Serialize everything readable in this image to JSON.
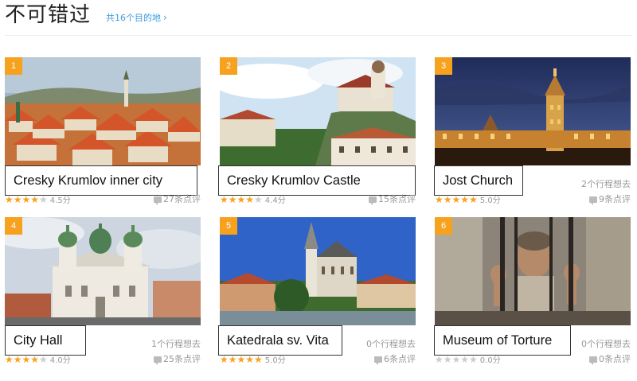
{
  "header": {
    "title": "不可错过",
    "more_link": "共16个目的地",
    "more_icon": "chevron-right-icon"
  },
  "cards": [
    {
      "rank": "1",
      "name": "Cresky Krumlov inner city",
      "trips": "",
      "score": "4.5分",
      "rating": 4.5,
      "reviews": "27条点评"
    },
    {
      "rank": "2",
      "name": "Cresky Krumlov Castle",
      "trips": "",
      "score": "4.4分",
      "rating": 4.5,
      "reviews": "15条点评"
    },
    {
      "rank": "3",
      "name": "Jost Church",
      "trips": "2个行程想去",
      "score": "5.0分",
      "rating": 5,
      "reviews": "9条点评"
    },
    {
      "rank": "4",
      "name": "City Hall",
      "trips": "1个行程想去",
      "score": "4.0分",
      "rating": 4,
      "reviews": "25条点评"
    },
    {
      "rank": "5",
      "name": "Katedrala sv. Vita",
      "trips": "0个行程想去",
      "score": "5.0分",
      "rating": 5,
      "reviews": "6条点评"
    },
    {
      "rank": "6",
      "name": "Museum of Torture",
      "trips": "0个行程想去",
      "score": "0.0分",
      "rating": 0,
      "reviews": "0条点评"
    }
  ],
  "colors": {
    "accent": "#f6a21f",
    "link": "#3a9bd8",
    "muted": "#999999"
  }
}
